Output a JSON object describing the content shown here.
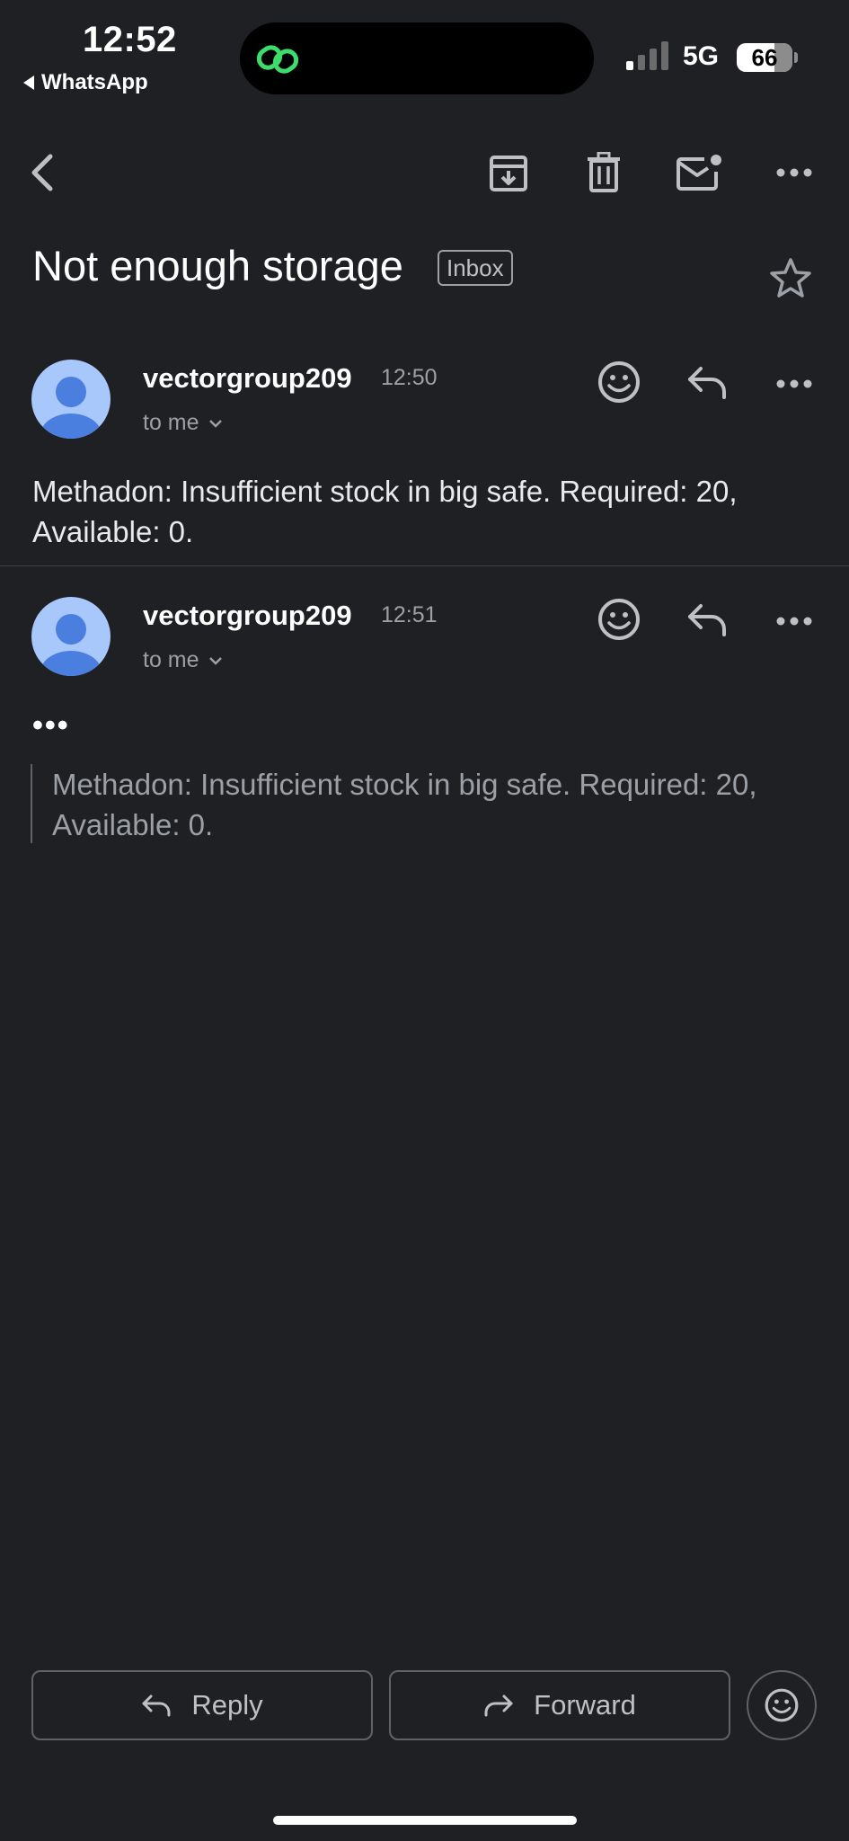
{
  "status_bar": {
    "time": "12:52",
    "back_app": "WhatsApp",
    "network": "5G",
    "battery": "66"
  },
  "toolbar": {
    "icons": [
      "back-icon",
      "archive-icon",
      "trash-icon",
      "mark-unread-icon",
      "more-icon"
    ]
  },
  "email": {
    "subject": "Not enough storage",
    "label": "Inbox"
  },
  "messages": [
    {
      "sender": "vectorgroup209",
      "time": "12:50",
      "recipient": "to me",
      "body": "Methadon: Insufficient stock in big safe. Required: 20, Available: 0."
    },
    {
      "sender": "vectorgroup209",
      "time": "12:51",
      "recipient": "to me",
      "ellipsis": "•••",
      "quoted": "Methadon: Insufficient stock in big safe. Required: 20, Available: 0."
    }
  ],
  "actions": {
    "reply": "Reply",
    "forward": "Forward"
  },
  "colors": {
    "background": "#1f2024",
    "avatar_bg": "#a8c7fa",
    "avatar_fg": "#4a7fe0",
    "island_icon": "#3ddc6b"
  }
}
